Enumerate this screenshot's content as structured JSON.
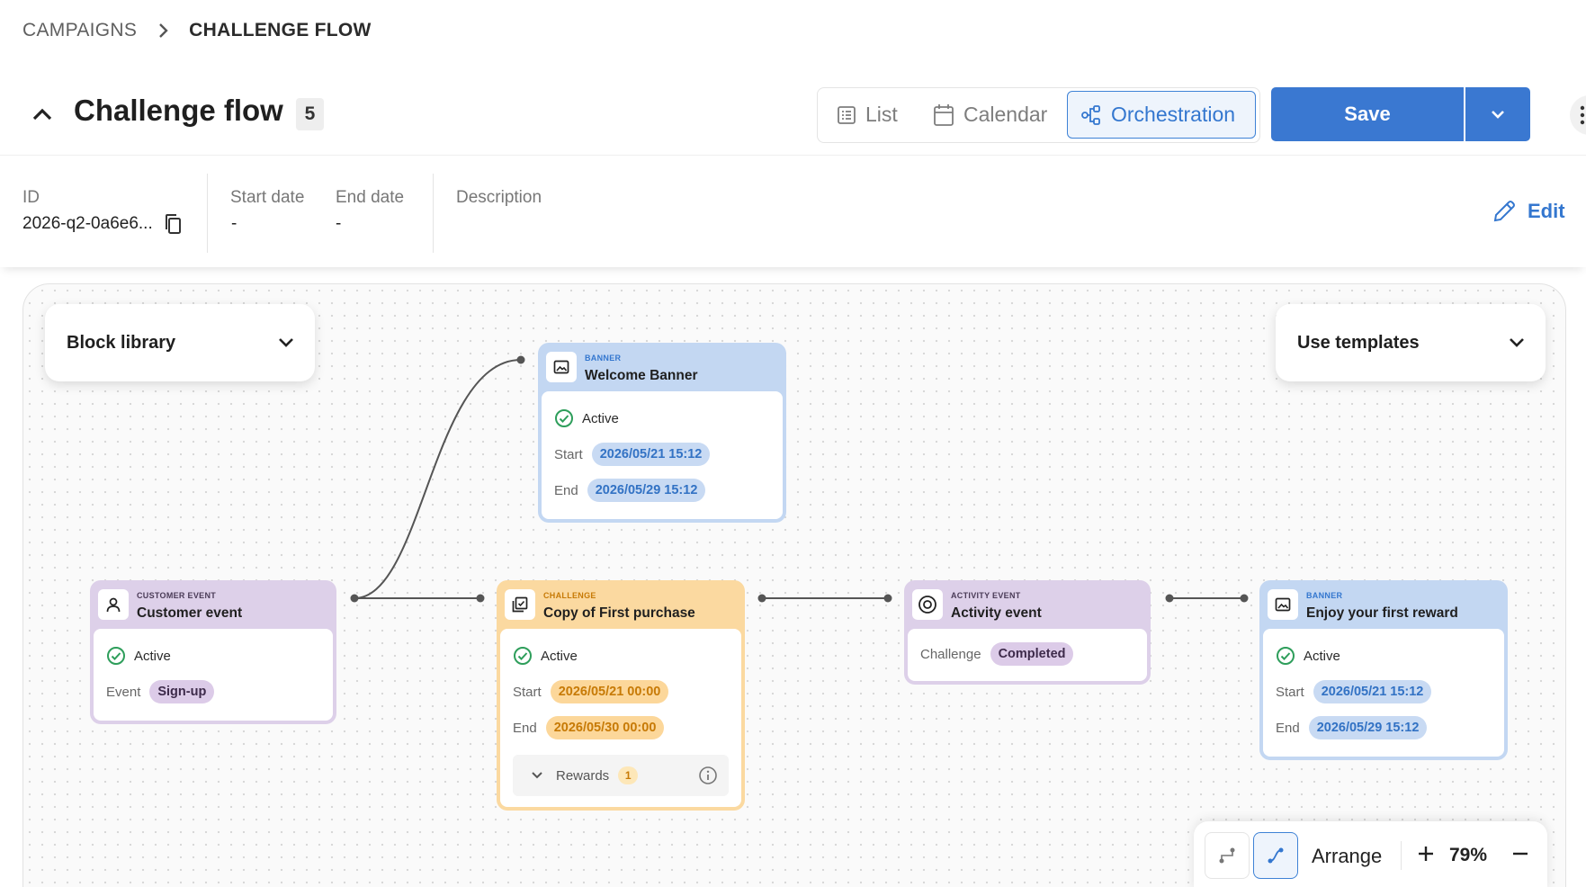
{
  "breadcrumb": {
    "parent": "CAMPAIGNS",
    "current": "CHALLENGE FLOW"
  },
  "header": {
    "title": "Challenge flow",
    "count": "5",
    "views": {
      "list": "List",
      "calendar": "Calendar",
      "orchestration": "Orchestration",
      "active": "Orchestration"
    },
    "save_label": "Save"
  },
  "info": {
    "id_label": "ID",
    "id_value": "2026-q2-0a6e6...",
    "start_label": "Start date",
    "start_value": "-",
    "end_label": "End date",
    "end_value": "-",
    "description_label": "Description",
    "edit_label": "Edit"
  },
  "canvas": {
    "block_library": "Block library",
    "use_templates": "Use templates",
    "arrange_label": "Arrange",
    "zoom": "79%"
  },
  "nodes": {
    "welcome": {
      "type": "BANNER",
      "name": "Welcome Banner",
      "status": "Active",
      "start_label": "Start",
      "start": "2026/05/21 15:12",
      "end_label": "End",
      "end": "2026/05/29 15:12"
    },
    "customer": {
      "type": "CUSTOMER EVENT",
      "name": "Customer event",
      "status": "Active",
      "event_label": "Event",
      "event": "Sign-up"
    },
    "challenge": {
      "type": "CHALLENGE",
      "name": "Copy of First purchase",
      "status": "Active",
      "start_label": "Start",
      "start": "2026/05/21 00:00",
      "end_label": "End",
      "end": "2026/05/30 00:00",
      "rewards_label": "Rewards",
      "rewards_count": "1"
    },
    "activity": {
      "type": "ACTIVITY EVENT",
      "name": "Activity event",
      "challenge_label": "Challenge",
      "challenge_value": "Completed"
    },
    "reward": {
      "type": "BANNER",
      "name": "Enjoy your first reward",
      "status": "Active",
      "start_label": "Start",
      "start": "2026/05/21 15:12",
      "end_label": "End",
      "end": "2026/05/29 15:12"
    }
  },
  "colors": {
    "accent": "#3a78d1",
    "banner": "#c3d7f2",
    "event": "#ddd0e9",
    "challenge": "#fbd9a0",
    "active_green": "#2e9e5b"
  }
}
